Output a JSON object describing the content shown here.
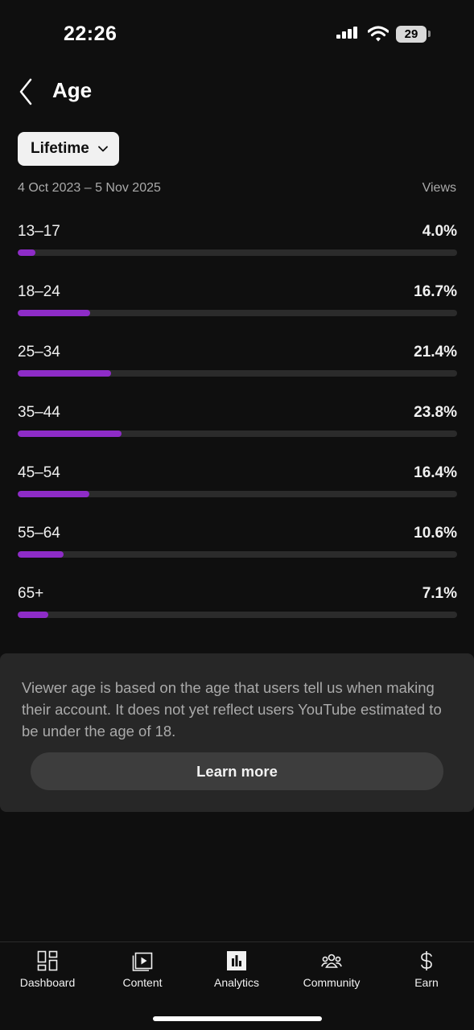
{
  "status_bar": {
    "time": "22:26",
    "battery": "29"
  },
  "header": {
    "title": "Age"
  },
  "filter": {
    "label": "Lifetime"
  },
  "summary": {
    "date_range": "4 Oct 2023 – 5 Nov 2025",
    "metric": "Views"
  },
  "age_groups": [
    {
      "label": "13–17",
      "value": "4.0%",
      "percent": 4.0
    },
    {
      "label": "18–24",
      "value": "16.7%",
      "percent": 16.7
    },
    {
      "label": "25–34",
      "value": "21.4%",
      "percent": 21.4
    },
    {
      "label": "35–44",
      "value": "23.8%",
      "percent": 23.8
    },
    {
      "label": "45–54",
      "value": "16.4%",
      "percent": 16.4
    },
    {
      "label": "55–64",
      "value": "10.6%",
      "percent": 10.6
    },
    {
      "label": "65+",
      "value": "7.1%",
      "percent": 7.1
    }
  ],
  "info": {
    "text": "Viewer age is based on the age that users tell us when making their account. It does not yet reflect users YouTube estimated to be under the age of 18.",
    "button": "Learn more"
  },
  "nav": {
    "items": [
      {
        "label": "Dashboard",
        "icon": "dashboard-icon"
      },
      {
        "label": "Content",
        "icon": "content-icon"
      },
      {
        "label": "Analytics",
        "icon": "analytics-icon",
        "active": true
      },
      {
        "label": "Community",
        "icon": "community-icon"
      },
      {
        "label": "Earn",
        "icon": "earn-icon"
      }
    ]
  },
  "colors": {
    "accent": "#8e2cc7",
    "background": "#0f0f0f",
    "card": "#272727",
    "track": "#2b2b2b"
  }
}
